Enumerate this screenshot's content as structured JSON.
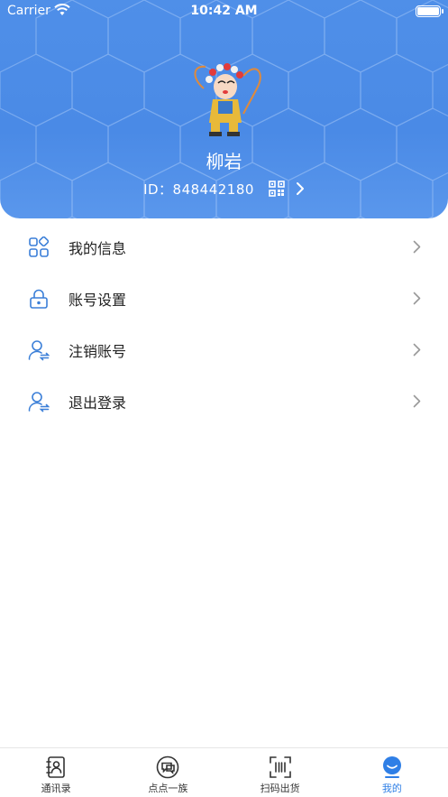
{
  "status_bar": {
    "carrier": "Carrier",
    "time": "10:42 AM"
  },
  "profile": {
    "name": "柳岩",
    "id_text": "ID：848442180"
  },
  "menu": [
    {
      "label": "我的信息",
      "icon": "apps-icon"
    },
    {
      "label": "账号设置",
      "icon": "lock-icon"
    },
    {
      "label": "注销账号",
      "icon": "user-switch-icon"
    },
    {
      "label": "退出登录",
      "icon": "user-switch-icon"
    }
  ],
  "tabbar": [
    {
      "label": "通讯录",
      "icon": "contacts-icon",
      "active": false
    },
    {
      "label": "点点一族",
      "icon": "chat-icon",
      "active": false
    },
    {
      "label": "扫码出货",
      "icon": "scan-icon",
      "active": false
    },
    {
      "label": "我的",
      "icon": "profile-icon",
      "active": true
    }
  ],
  "colors": {
    "header": "#4a8ae6",
    "accent": "#2f7fe6",
    "icon_blue": "#3b7fd8"
  }
}
